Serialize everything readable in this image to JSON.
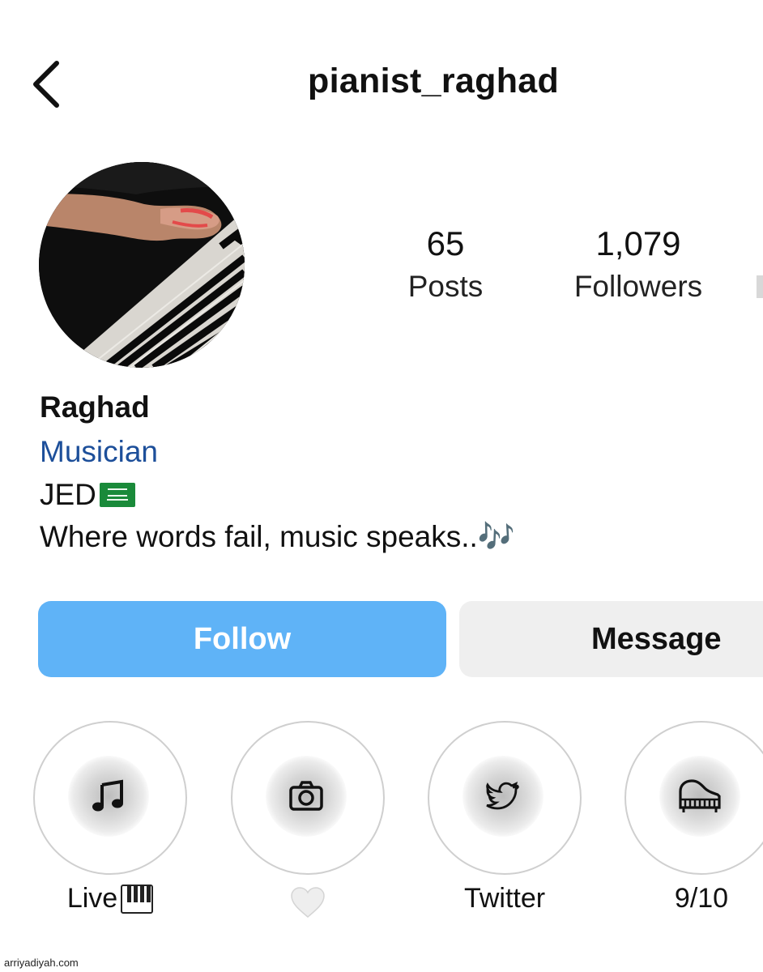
{
  "header": {
    "username": "pianist_raghad",
    "back_icon": "chevron-left-icon"
  },
  "stats": {
    "posts_count": "65",
    "posts_label": "Posts",
    "followers_count": "1,079",
    "followers_label": "Followers"
  },
  "bio": {
    "name": "Raghad",
    "category": "Musician",
    "location": "JED",
    "location_flag": "saudi-flag-emoji",
    "text": "Where words fail, music speaks..🎶"
  },
  "actions": {
    "follow_label": "Follow",
    "message_label": "Message"
  },
  "highlights": [
    {
      "label": "Live",
      "icon": "music-note-icon",
      "suffix_emoji": "piano-keys-emoji"
    },
    {
      "label": "",
      "icon": "camera-icon",
      "suffix_emoji": "white-heart-emoji"
    },
    {
      "label": "Twitter",
      "icon": "twitter-bird-icon"
    },
    {
      "label": "9/10",
      "icon": "grand-piano-icon"
    }
  ],
  "watermark": "arriyadiyah.com",
  "colors": {
    "follow_button": "#5fb3f7",
    "message_button": "#efefef",
    "category_link": "#1d4f9a"
  }
}
